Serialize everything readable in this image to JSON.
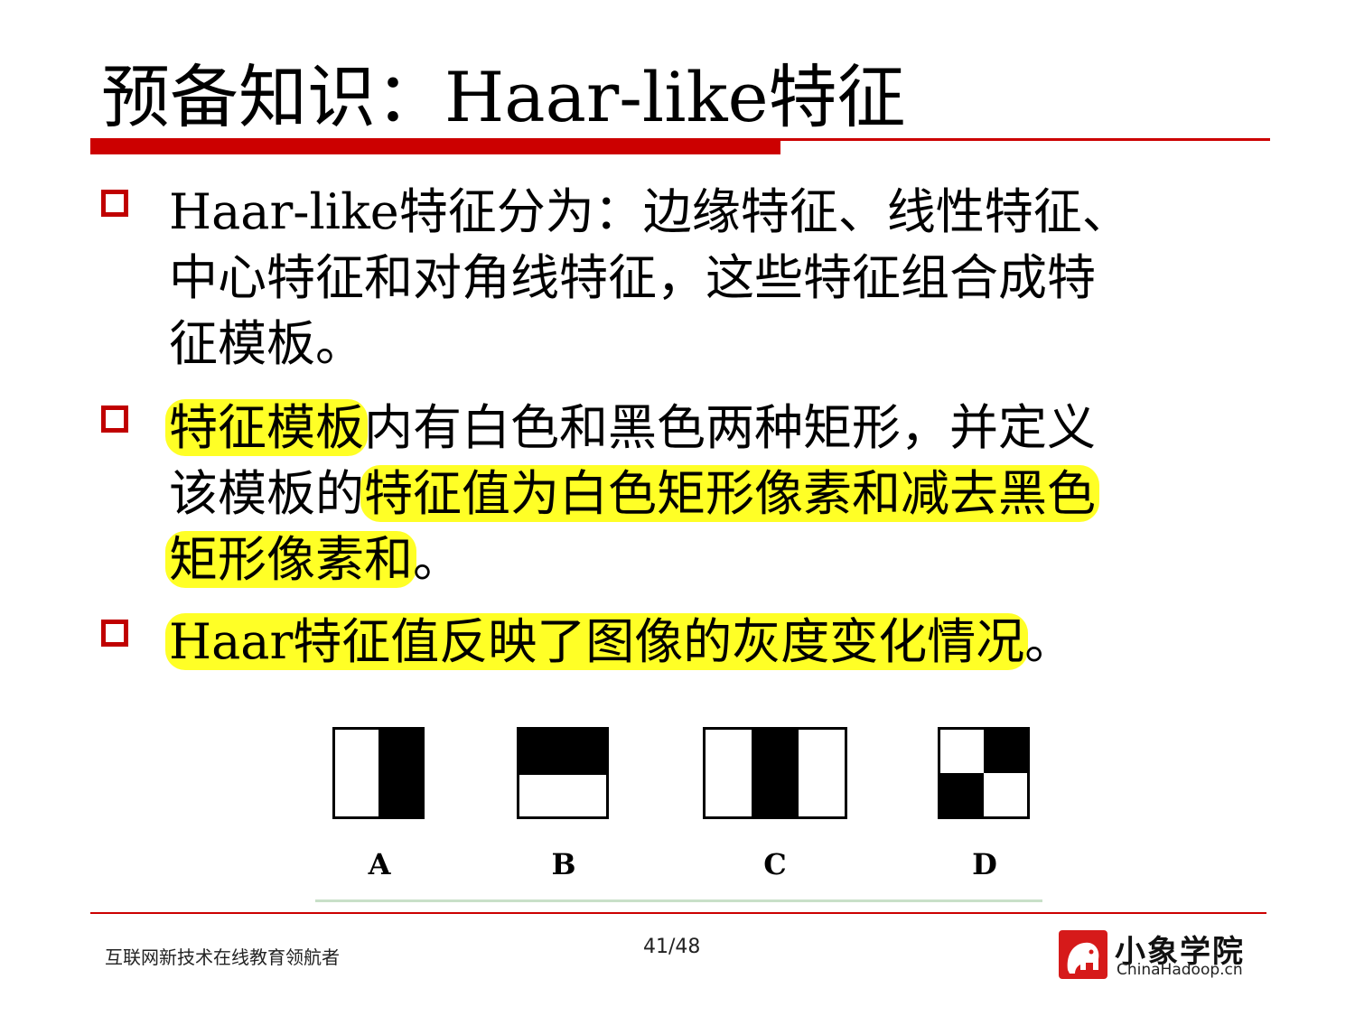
{
  "slide": {
    "title": "预备知识：Haar-like特征",
    "bullets": [
      {
        "lines": [
          [
            {
              "t": "Haar-like特征分为：边缘特征、线性特征、",
              "hl": false
            }
          ],
          [
            {
              "t": "中心特征和对角线特征，这些特征组合成特",
              "hl": false
            }
          ],
          [
            {
              "t": "征模板。",
              "hl": false
            }
          ]
        ]
      },
      {
        "lines": [
          [
            {
              "t": "特征模板",
              "hl": true
            },
            {
              "t": "内有白色和黑色两种矩形，并定义",
              "hl": false
            }
          ],
          [
            {
              "t": "该模板的",
              "hl": false
            },
            {
              "t": "特征值为白色矩形像素和减去黑色",
              "hl": true
            }
          ],
          [
            {
              "t": "矩形像素和",
              "hl": true
            },
            {
              "t": "。",
              "hl": false
            }
          ]
        ]
      },
      {
        "lines": [
          [
            {
              "t": "Haar特征值反映了图像的灰度变化情况",
              "hl": true
            },
            {
              "t": "。",
              "hl": false
            }
          ]
        ]
      }
    ],
    "figure": {
      "labels": [
        "A",
        "B",
        "C",
        "D"
      ]
    }
  },
  "footer": {
    "left_text": "互联网新技术在线教育领航者",
    "page_number": "41/48",
    "logo_name": "小象学院",
    "logo_url_text": "ChinaHadoop.cn"
  },
  "colors": {
    "accent_red": "#cc0000",
    "highlight_yellow": "#ffff26"
  }
}
